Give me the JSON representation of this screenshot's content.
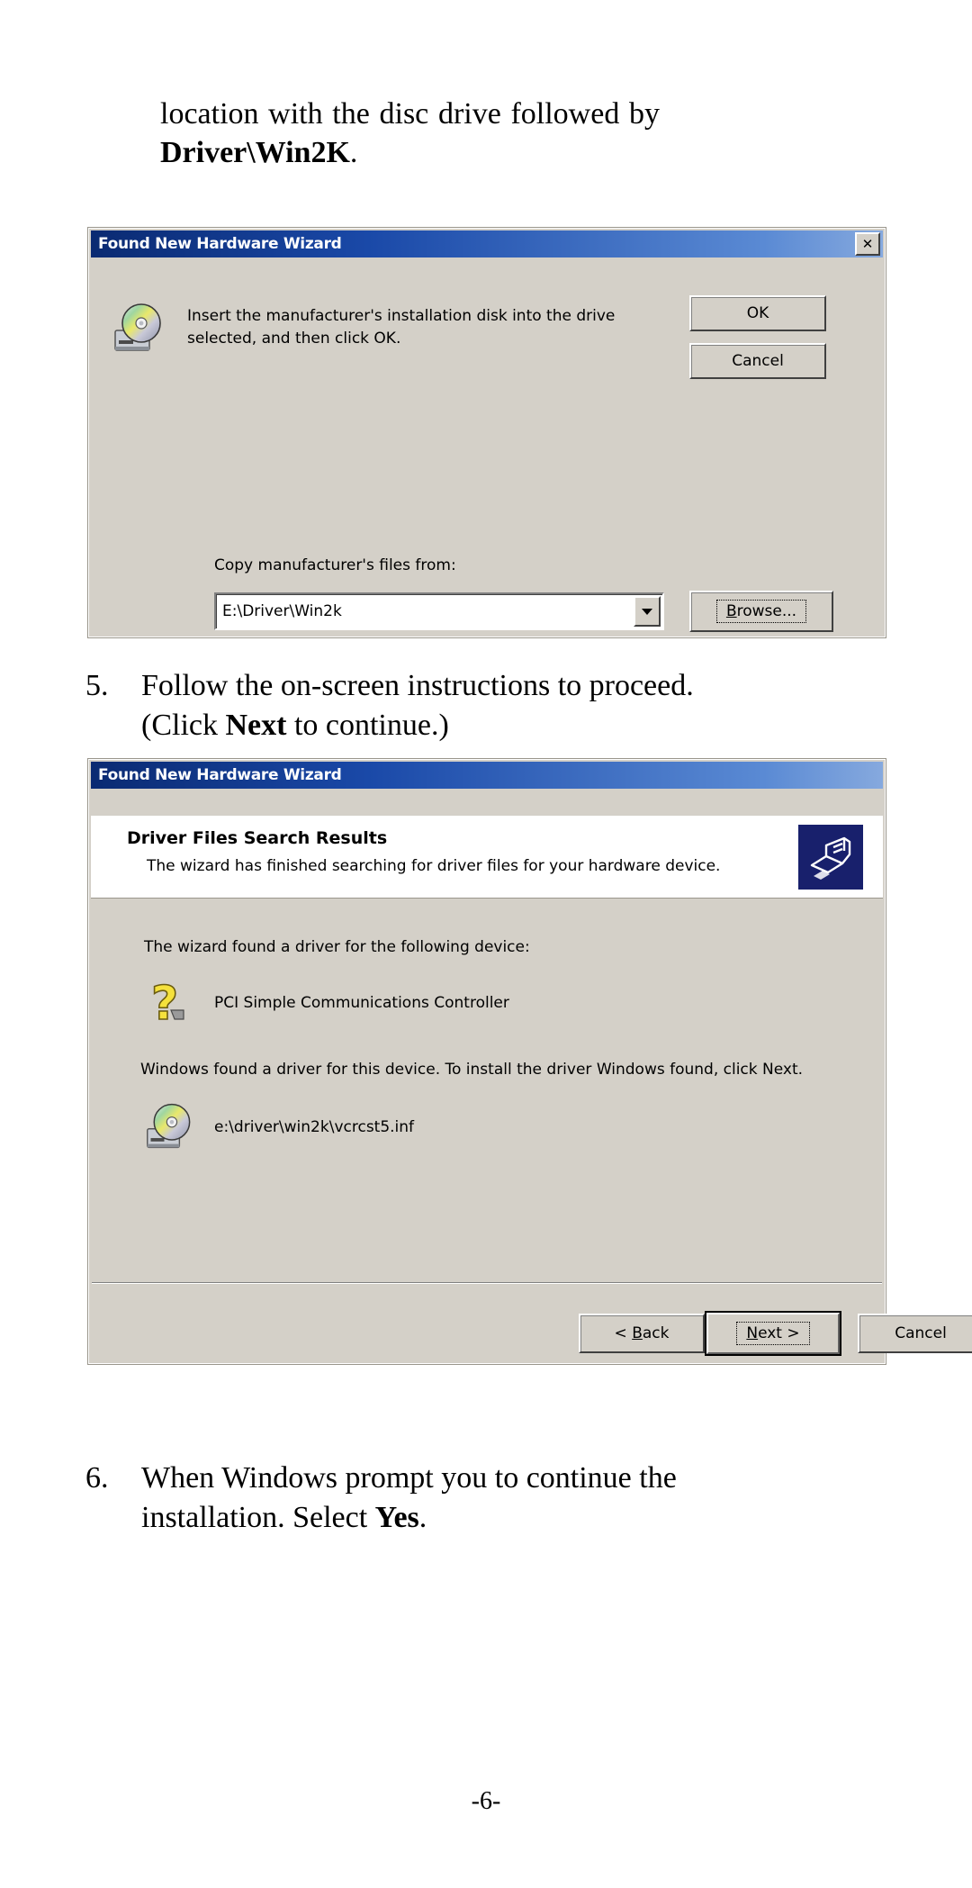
{
  "page": {
    "page_number": "-6-"
  },
  "prose": {
    "intro_line1": "location  with  the  disc  drive  followed  by",
    "intro_bold": "Driver\\Win2K",
    "intro_period": ".",
    "step5": {
      "number": "5.",
      "line1": "Follow the on-screen instructions to proceed.",
      "line2_pre": "(Click ",
      "line2_bold": "Next",
      "line2_post": " to continue.)"
    },
    "step6": {
      "number": "6.",
      "line1": "When Windows prompt you to continue the",
      "line2_pre": "installation.  Select ",
      "line2_bold": "Yes",
      "line2_post": "."
    }
  },
  "dialog1": {
    "title": "Found New Hardware Wizard",
    "close_glyph": "✕",
    "cd_icon": "cd-drive-icon",
    "message": "Insert the manufacturer's installation disk into the drive\nselected, and then click OK.",
    "ok_label": "OK",
    "cancel_label": "Cancel",
    "copy_from_label": "Copy manufacturer's files from:",
    "path_value": "E:\\Driver\\Win2k",
    "dropdown_icon": "chevron-down-icon",
    "browse_label_pre": "B",
    "browse_label_post": "rowse..."
  },
  "dialog2": {
    "title": "Found New Hardware Wizard",
    "header_title": "Driver Files Search Results",
    "header_subtitle": "The wizard has finished searching for driver files for your hardware device.",
    "banner_icon": "wizard-banner-icon",
    "found_line": "The wizard found a driver for the following device:",
    "device_icon": "unknown-device-icon",
    "device_name": "PCI Simple Communications Controller",
    "install_line": "Windows found a driver for this device. To install the driver Windows found, click Next.",
    "inf_icon": "cd-drive-icon",
    "inf_path": "e:\\driver\\win2k\\vcrcst5.inf",
    "back_pre": "< ",
    "back_underline": "B",
    "back_post": "ack",
    "next_underline": "N",
    "next_post": "ext >",
    "cancel_label": "Cancel"
  },
  "colors": {
    "dialog_face": "#d4d0c8",
    "titlebar_dark": "#0a2a72",
    "titlebar_light": "#86a9de",
    "banner_blue": "#18206c"
  }
}
